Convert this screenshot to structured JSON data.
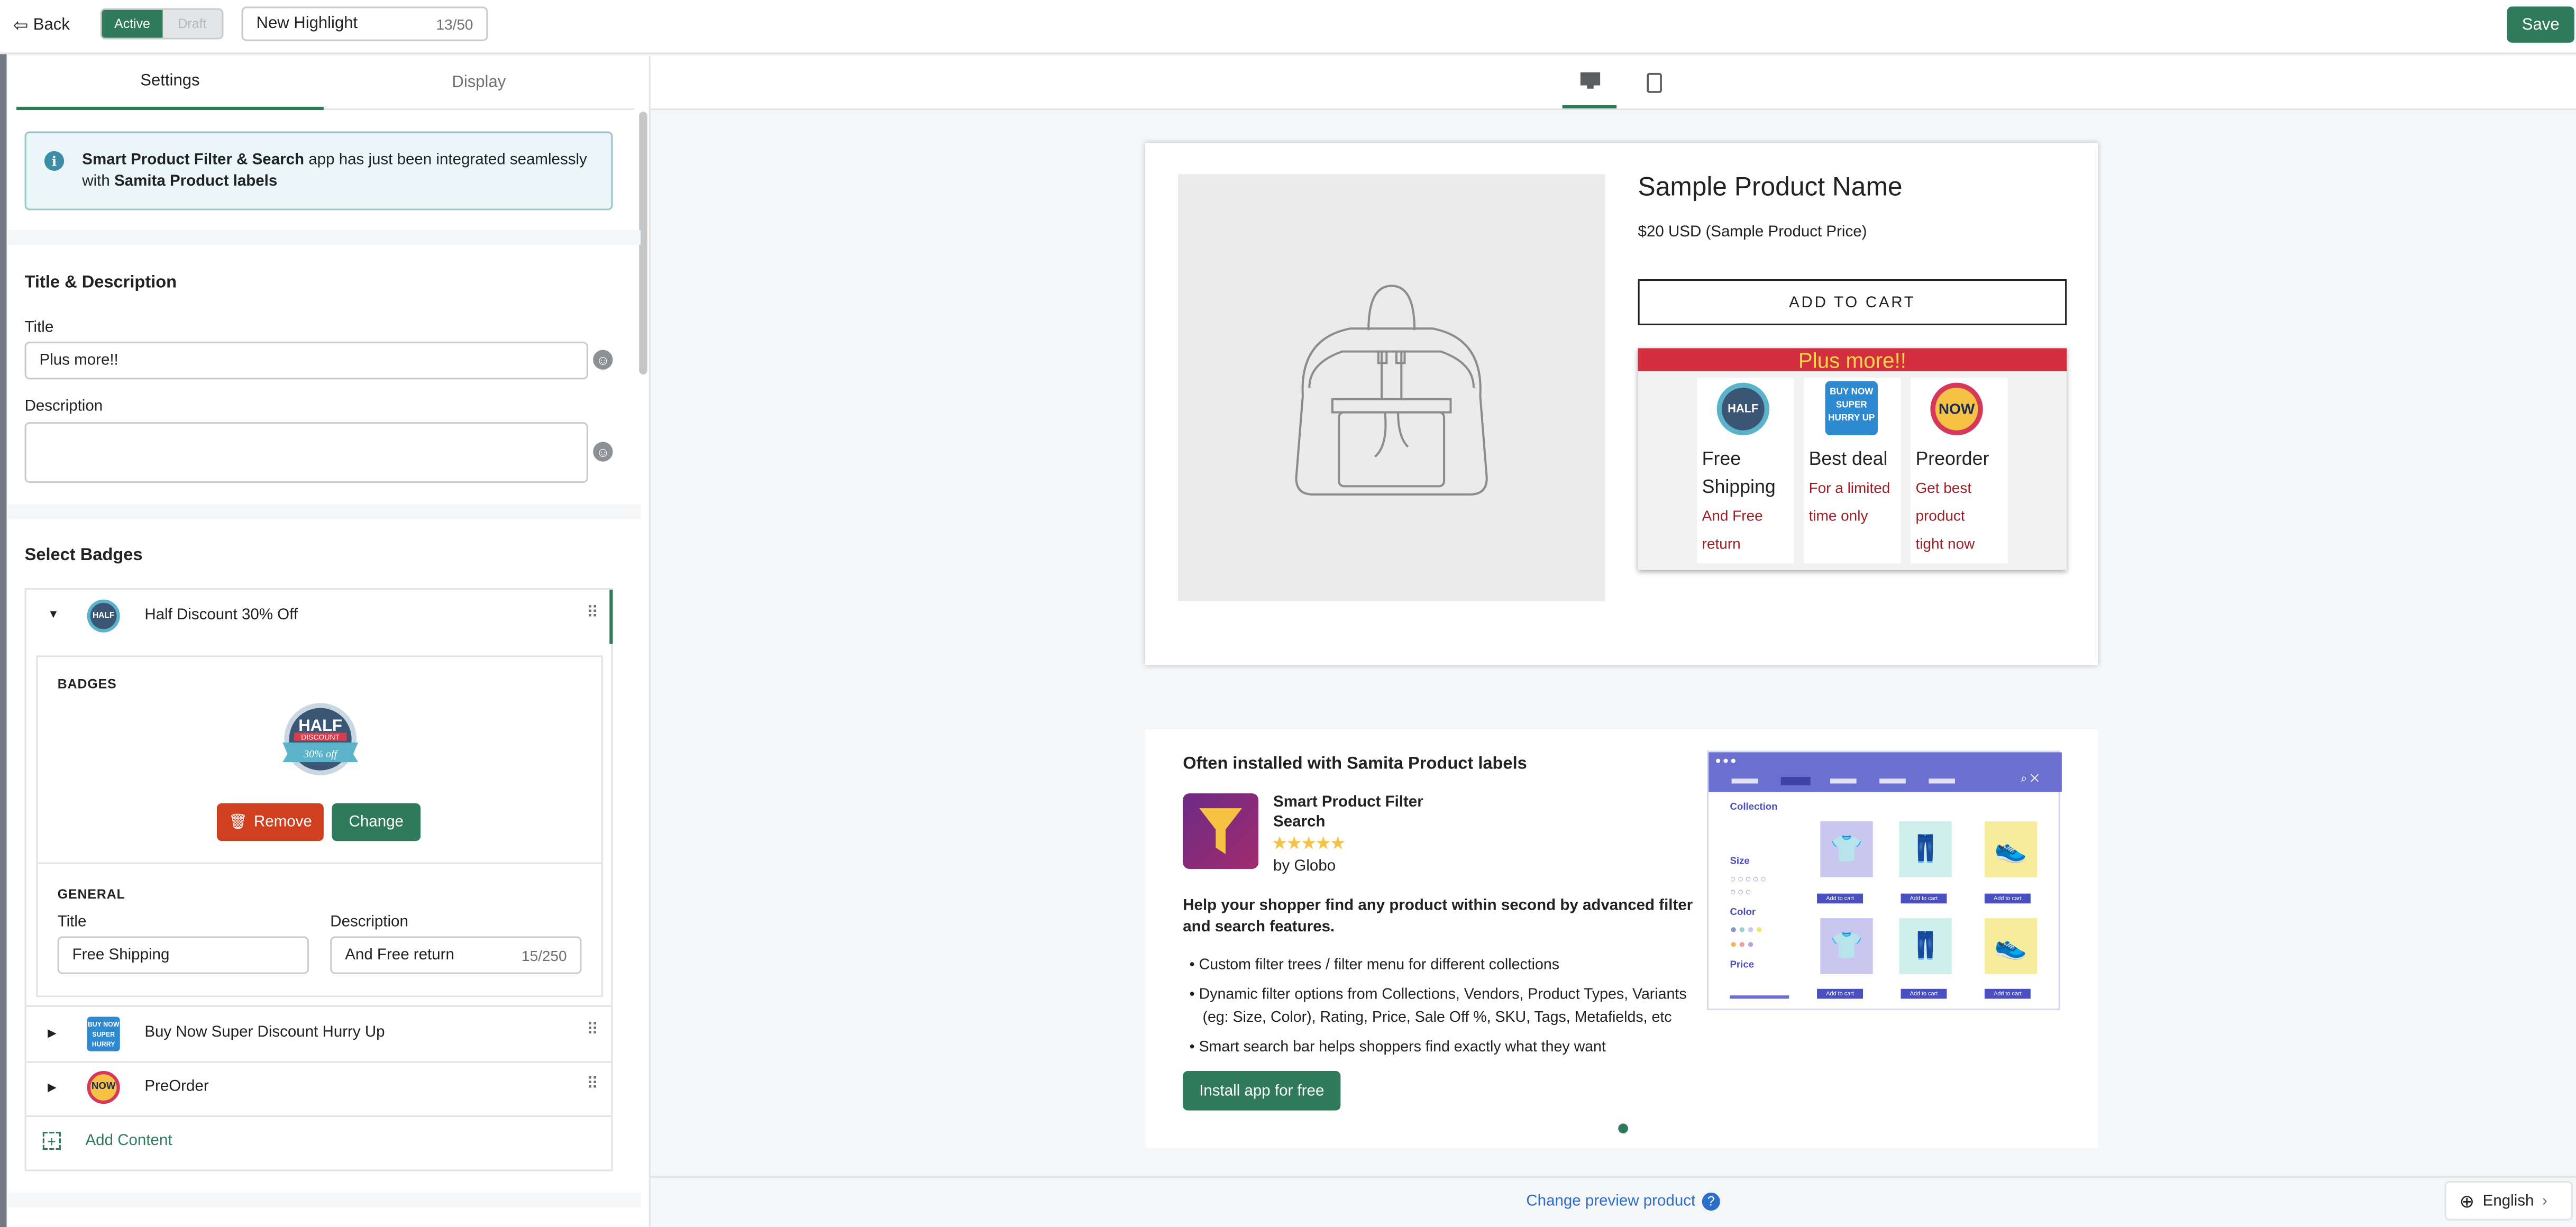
{
  "topbar": {
    "back_label": "Back",
    "status_active": "Active",
    "status_draft": "Draft",
    "name_value": "New Highlight",
    "name_count": "13/50",
    "save_label": "Save"
  },
  "tabs": {
    "settings": "Settings",
    "display": "Display"
  },
  "info": {
    "app_name": "Smart Product Filter & Search",
    "middle": " app has just been integrated seamlessly with ",
    "product": "Samita Product labels"
  },
  "title_desc": {
    "heading": "Title & Description",
    "title_label": "Title",
    "title_value": "Plus more!!",
    "desc_label": "Description",
    "desc_value": ""
  },
  "badges": {
    "heading": "Select Badges",
    "items": [
      {
        "name": "Half Discount 30% Off",
        "icon": "half-discount-badge-icon"
      },
      {
        "name": "Buy Now Super Discount Hurry Up",
        "icon": "buy-now-badge-icon"
      },
      {
        "name": "PreOrder",
        "icon": "preorder-badge-icon"
      }
    ],
    "expanded": {
      "section_badges": "BADGES",
      "remove_label": "Remove",
      "change_label": "Change",
      "section_general": "GENERAL",
      "title_label": "Title",
      "title_value": "Free Shipping",
      "desc_label": "Description",
      "desc_value": "And Free return",
      "desc_count": "15/250"
    },
    "add_content": "Add Content"
  },
  "preview": {
    "product_name": "Sample Product Name",
    "product_price": "$20 USD (Sample Product Price)",
    "add_to_cart": "ADD TO CART",
    "highlight_title": "Plus more!!",
    "highlights": [
      {
        "title1": "Free",
        "title2": "Shipping",
        "d1": "And Free",
        "d2": "return",
        "d3": ""
      },
      {
        "title1": "Best deal",
        "title2": "",
        "d1": "For a limited",
        "d2": "time only",
        "d3": ""
      },
      {
        "title1": "Preorder",
        "title2": "",
        "d1": "Get best",
        "d2": "product",
        "d3": "tight now"
      }
    ],
    "change_preview": "Change preview product",
    "language": "English"
  },
  "upsell": {
    "heading": "Often installed with Samita Product labels",
    "app_name_1": "Smart Product Filter",
    "app_name_2": "Search",
    "by": "by Globo",
    "tagline_1": "Help your shopper find any product within second by advanced filter",
    "tagline_2": "and search features.",
    "bullets": [
      "Custom filter trees / filter menu for different collections",
      "Dynamic filter options from Collections, Vendors, Product Types, Variants",
      "(eg: Size, Color), Rating, Price, Sale Off %, SKU, Tags, Metafields, etc",
      "Smart search bar helps shoppers find exactly what they want"
    ],
    "install_label": "Install app for free",
    "mock": {
      "collection": "Collection",
      "size": "Size",
      "color": "Color",
      "price": "Price",
      "add": "Add to cart"
    }
  },
  "colors": {
    "accent": "#2f7a5b",
    "remove": "#d0401f",
    "highlight_bar": "#d42d3e",
    "highlight_title_text": "#f3d84b",
    "highlight_desc": "#9c1d24"
  }
}
